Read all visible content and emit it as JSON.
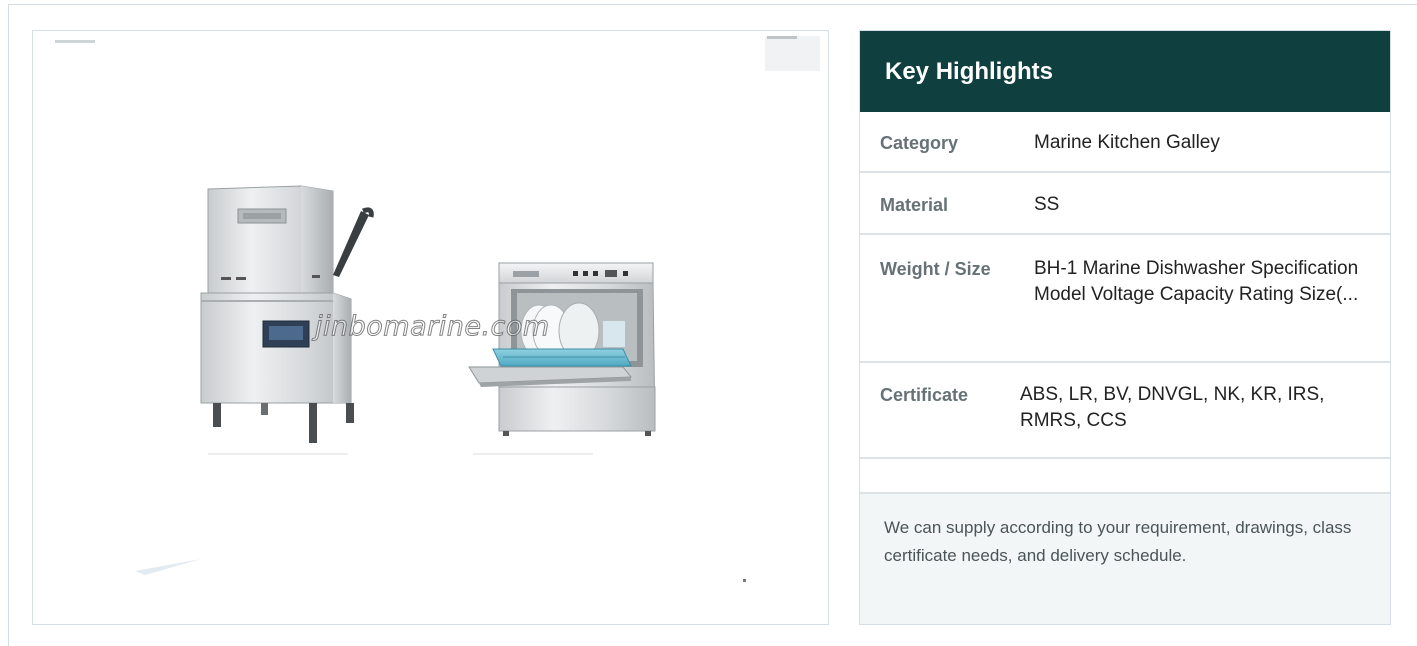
{
  "product": {
    "image_alt": "BH-1 Marine Dishwasher",
    "watermark": "jinbomarine.com"
  },
  "highlights": {
    "title": "Key Highlights",
    "rows": [
      {
        "label": "Category",
        "value": "Marine Kitchen Galley"
      },
      {
        "label": "Material",
        "value": "SS"
      },
      {
        "label": "Weight / Size",
        "value": "BH-1 Marine Dishwasher Specification Model Voltage Capacity Rating Size(..."
      },
      {
        "label": "Certificate",
        "value": "ABS, LR, BV, DNVGL, NK, KR, IRS, RMRS, CCS"
      }
    ],
    "note": "We can supply according to your requirement, drawings, class certificate needs, and delivery schedule."
  },
  "colors": {
    "header_bg": "#0f3f3f",
    "label_text": "#667275",
    "row_border": "#dbe3e7",
    "note_bg": "#f2f6f7"
  }
}
